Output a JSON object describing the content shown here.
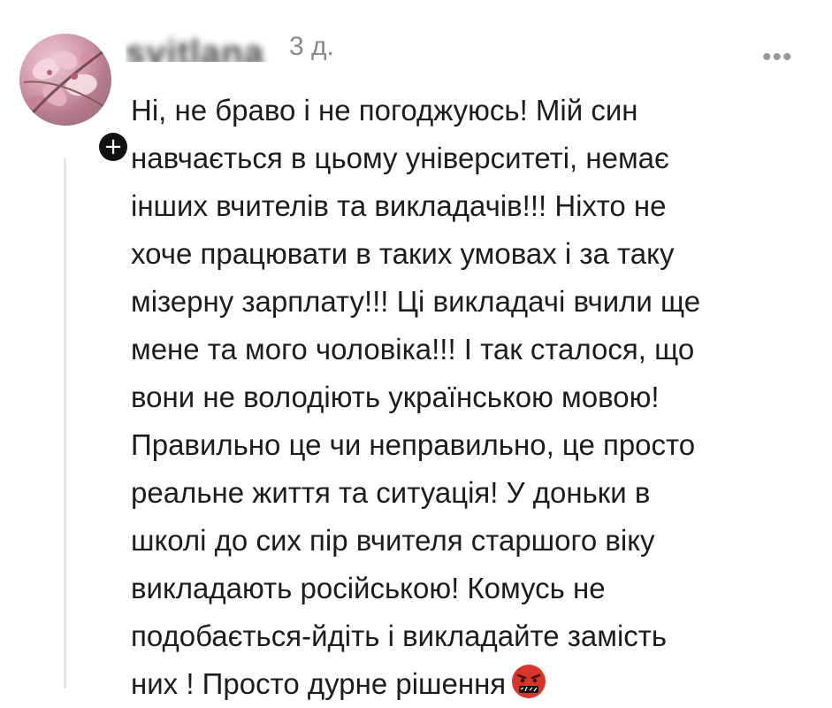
{
  "comment": {
    "username_obscured": "svitlana",
    "timestamp": "3 д.",
    "more_label": "•••",
    "follow_symbol": "+",
    "lines": [
      "Ні, не браво і не погоджуюсь! Мій син",
      "навчається в цьому університеті, немає",
      "інших вчителів та викладачів!!! Ніхто не",
      "хоче працювати в таких умовах і за таку",
      "мізерну зарплату!!! Ці викладачі вчили ще",
      "мене та мого чоловіка!!! І так сталося, що",
      "вони не володіють українською мовою!",
      "Правильно це чи неправильно, це просто",
      "реальне життя та ситуація! У доньки в",
      "школі до сих пір вчителя старшого віку",
      "викладають російською! Комусь не",
      "подобається-йдіть і викладайте замість",
      "них ! Просто дурне рішення"
    ],
    "emoji": "face-with-symbols-on-mouth-icon"
  },
  "colors": {
    "text": "#1d1d1d",
    "timestamp": "#8a8a8a",
    "thread_line": "#e6e6e6",
    "badge": "#111111",
    "emoji_face": "#d8342a"
  }
}
